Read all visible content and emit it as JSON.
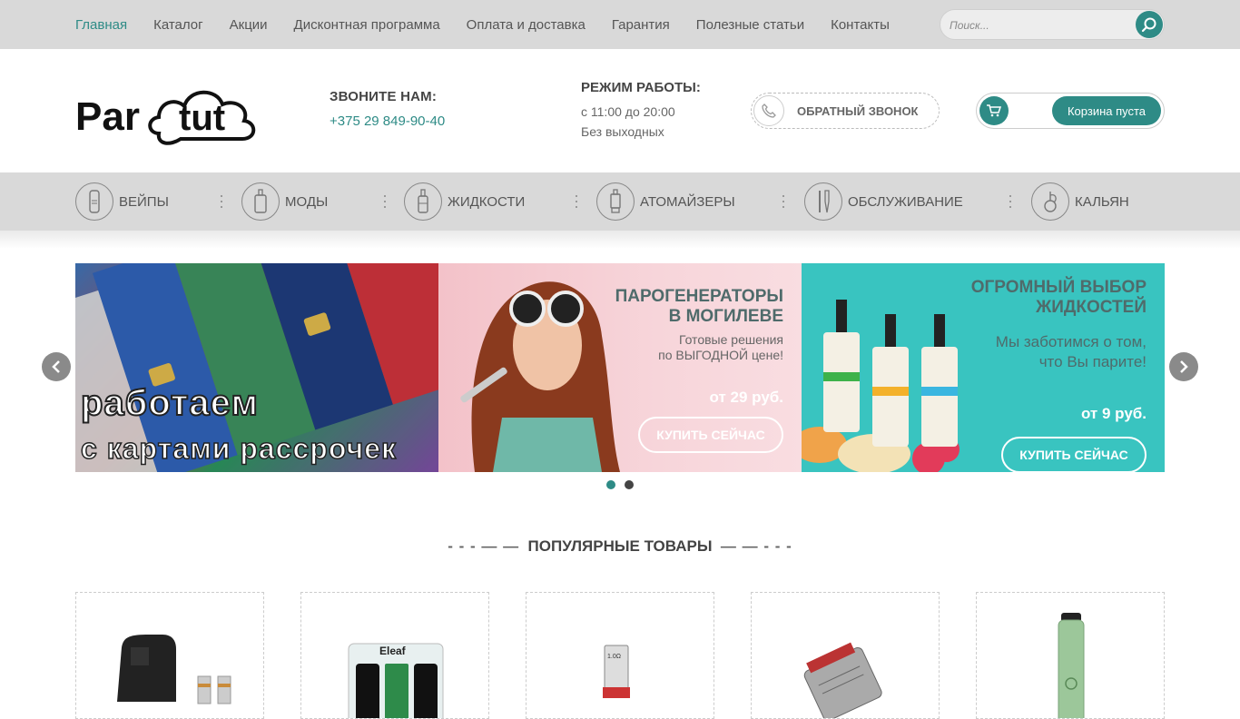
{
  "nav": {
    "items": [
      "Главная",
      "Каталог",
      "Акции",
      "Дисконтная программа",
      "Оплата и доставка",
      "Гарантия",
      "Полезные статьи",
      "Контакты"
    ],
    "search_placeholder": "Поиск..."
  },
  "header": {
    "logo_text": "Par tut",
    "call_label": "ЗВОНИТЕ НАМ:",
    "phone": "+375 29 849-90-40",
    "hours_label": "РЕЖИМ РАБОТЫ:",
    "hours_line1": "с 11:00 до 20:00",
    "hours_line2": "Без выходных",
    "callback_label": "ОБРАТНЫЙ ЗВОНОК",
    "cart_label": "Корзина пуста"
  },
  "categories": [
    {
      "name": "ВЕЙПЫ",
      "icon": "vape-icon"
    },
    {
      "name": "МОДЫ",
      "icon": "mod-icon"
    },
    {
      "name": "ЖИДКОСТИ",
      "icon": "liquid-bottle-icon"
    },
    {
      "name": "АТОМАЙЗЕРЫ",
      "icon": "atomizer-icon"
    },
    {
      "name": "ОБСЛУЖИВАНИЕ",
      "icon": "tools-icon"
    },
    {
      "name": "КАЛЬЯН",
      "icon": "hookah-icon"
    }
  ],
  "slides": {
    "s1": {
      "line1": "работаем",
      "line2": "с картами рассрочек"
    },
    "s2": {
      "title_line1": "ПАРОГЕНЕРАТОРЫ",
      "title_line2": "В МОГИЛЕВЕ",
      "sub_line1": "Готовые решения",
      "sub_line2": "по ВЫГОДНОЙ цене!",
      "price": "от 29 руб.",
      "button": "КУПИТЬ СЕЙЧАС"
    },
    "s3": {
      "title_line1": "ОГРОМНЫЙ ВЫБОР",
      "title_line2": "ЖИДКОСТЕЙ",
      "sub_line1": "Мы заботимся о том,",
      "sub_line2": "что Вы парите!",
      "price": "от 9 руб.",
      "button": "КУПИТЬ СЕЙЧАС"
    }
  },
  "popular": {
    "title": "ПОПУЛЯРНЫЕ ТОВАРЫ"
  },
  "colors": {
    "accent": "#2e8b86",
    "bar": "#d9d9d9"
  }
}
